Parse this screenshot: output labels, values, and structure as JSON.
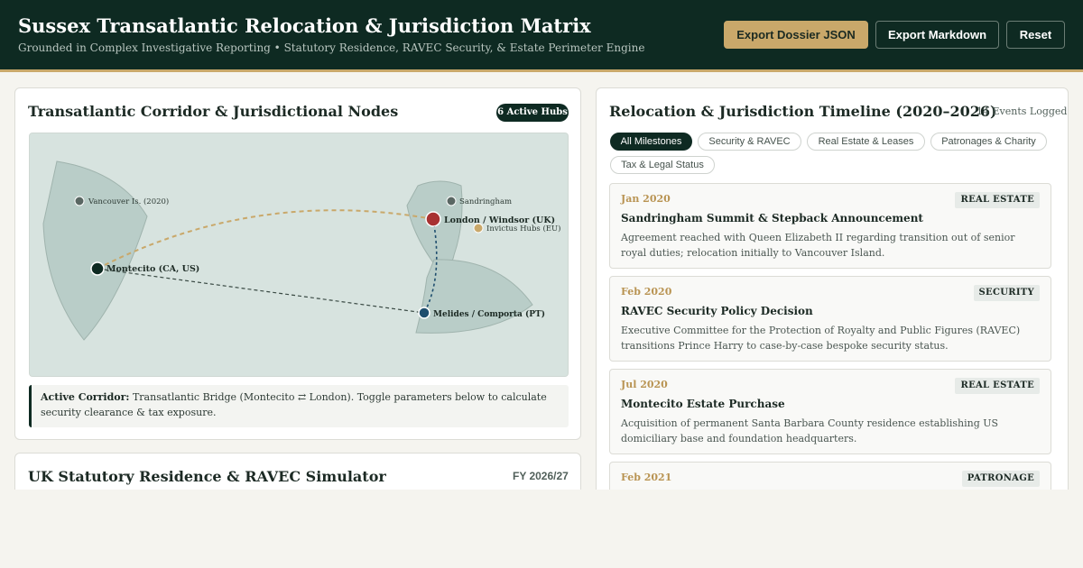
{
  "header": {
    "title": "Sussex Transatlantic Relocation & Jurisdiction Matrix",
    "subtitle": "Grounded in Complex Investigative Reporting • Statutory Residence, RAVEC Security, & Estate Perimeter Engine",
    "buttons": {
      "export_json": "Export Dossier JSON",
      "export_md": "Export Markdown",
      "reset": "Reset"
    }
  },
  "map_panel": {
    "title": "Transatlantic Corridor & Jurisdictional Nodes",
    "badge": "6 Active Hubs",
    "nodes": {
      "vancouver": "Vancouver Is. (2020)",
      "sandringham": "Sandringham",
      "london": "London / Windsor (UK)",
      "invictus": "Invictus Hubs (EU)",
      "montecito": "Montecito (CA, US)",
      "melides": "Melides / Comporta (PT)"
    },
    "note_label": "Active Corridor:",
    "note_text": " Transatlantic Bridge (Montecito ⇄ London). Toggle parameters below to calculate security clearance & tax exposure."
  },
  "simulator": {
    "title": "UK Statutory Residence & RAVEC Simulator",
    "fiscal_year": "FY 2026/27"
  },
  "timeline": {
    "title": "Relocation & Jurisdiction Timeline (2020–2026)",
    "count": "14 Events Logged",
    "filters": [
      "All Milestones",
      "Security & RAVEC",
      "Real Estate & Leases",
      "Patronages & Charity",
      "Tax & Legal Status"
    ],
    "events": [
      {
        "date": "Jan 2020",
        "tag": "REAL ESTATE",
        "title": "Sandringham Summit & Stepback Announcement",
        "desc": "Agreement reached with Queen Elizabeth II regarding transition out of senior royal duties; relocation initially to Vancouver Island."
      },
      {
        "date": "Feb 2020",
        "tag": "SECURITY",
        "title": "RAVEC Security Policy Decision",
        "desc": "Executive Committee for the Protection of Royalty and Public Figures (RAVEC) transitions Prince Harry to case-by-case bespoke security status."
      },
      {
        "date": "Jul 2020",
        "tag": "REAL ESTATE",
        "title": "Montecito Estate Purchase",
        "desc": "Acquisition of permanent Santa Barbara County residence establishing US domiciliary base and foundation headquarters."
      },
      {
        "date": "Feb 2021",
        "tag": "PATRONAGE",
        "title": "",
        "desc": ""
      }
    ]
  },
  "colors": {
    "header_bg": "#0e2a22",
    "accent_gold": "#c9a86a",
    "london_node": "#a83232",
    "melides_node": "#1f4e6e",
    "land": "#b9cdc8",
    "sea": "#d7e3df"
  }
}
